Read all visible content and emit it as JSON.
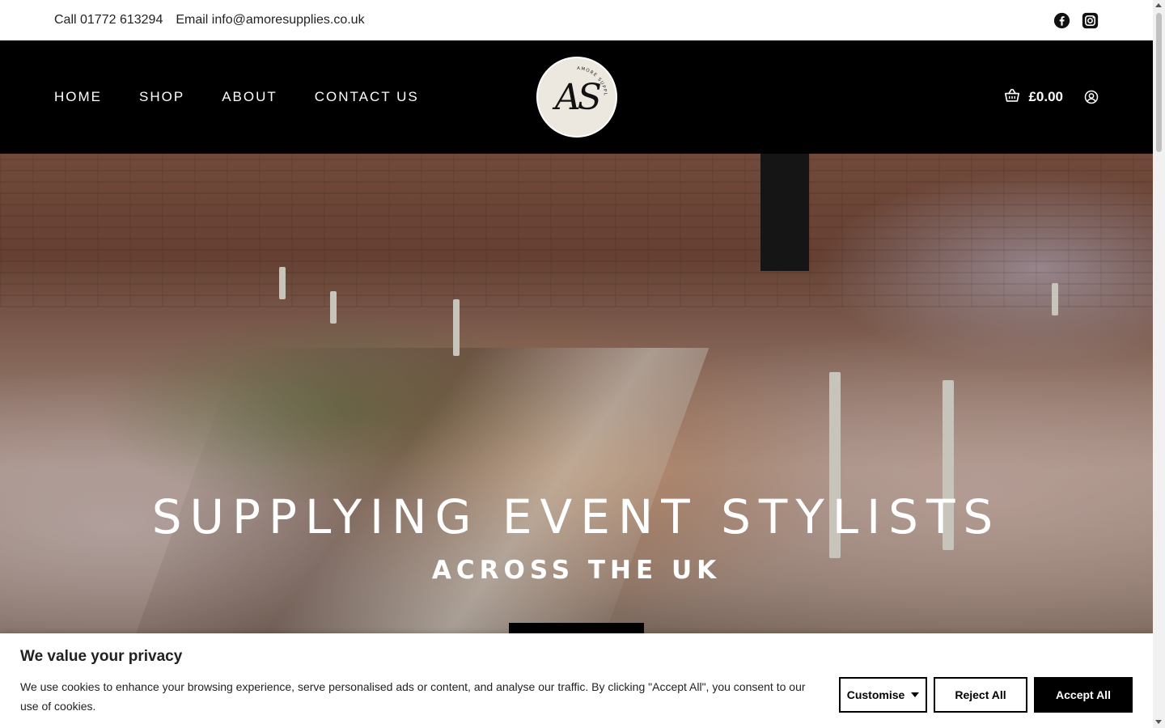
{
  "topbar": {
    "phone": "Call 01772 613294",
    "email": "Email info@amoresupplies.co.uk",
    "social_icons": [
      "facebook-icon",
      "instagram-icon"
    ]
  },
  "header": {
    "nav": [
      {
        "label": "HOME"
      },
      {
        "label": "SHOP"
      },
      {
        "label": "ABOUT"
      },
      {
        "label": "CONTACT US"
      }
    ],
    "logo": {
      "monogram": "AS",
      "arc_text": "AMORE SUPPLIES"
    },
    "cart_total": "£0.00",
    "icons": [
      "basket-icon",
      "account-icon"
    ]
  },
  "hero": {
    "title": "SUPPLYING EVENT STYLISTS",
    "subtitle": "ACROSS THE UK"
  },
  "cookie": {
    "heading": "We value your privacy",
    "text": "We use cookies to enhance your browsing experience, serve personalised ads or content, and analyse our traffic. By clicking \"Accept All\", you consent to our use of cookies.",
    "customise_label": "Customise",
    "reject_label": "Reject All",
    "accept_label": "Accept All"
  },
  "colors": {
    "header_bg": "#000000",
    "logo_bg": "#ece7df",
    "accent_text": "#ffffff"
  }
}
